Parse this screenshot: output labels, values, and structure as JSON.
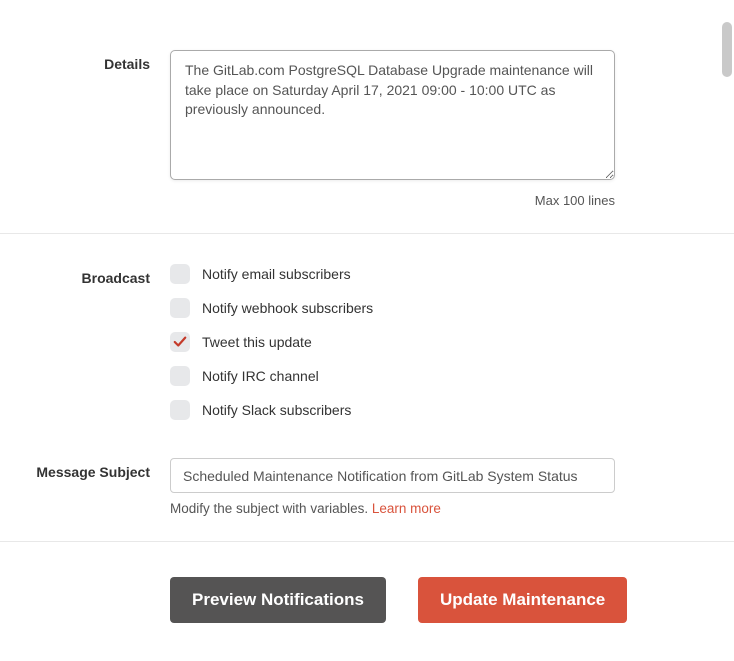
{
  "details": {
    "label": "Details",
    "value": "The GitLab.com PostgreSQL Database Upgrade maintenance will take place on Saturday April 17, 2021 09:00 - 10:00 UTC as previously announced.",
    "hint": "Max 100 lines"
  },
  "broadcast": {
    "label": "Broadcast",
    "options": [
      {
        "label": "Notify email subscribers",
        "checked": false
      },
      {
        "label": "Notify webhook subscribers",
        "checked": false
      },
      {
        "label": "Tweet this update",
        "checked": true
      },
      {
        "label": "Notify IRC channel",
        "checked": false
      },
      {
        "label": "Notify Slack subscribers",
        "checked": false
      }
    ]
  },
  "subject": {
    "label": "Message Subject",
    "value": "Scheduled Maintenance Notification from GitLab System Status",
    "helper_prefix": "Modify the subject with variables. ",
    "learn_more": "Learn more"
  },
  "buttons": {
    "preview": "Preview Notifications",
    "update": "Update Maintenance"
  },
  "colors": {
    "accent": "#d9533c"
  }
}
